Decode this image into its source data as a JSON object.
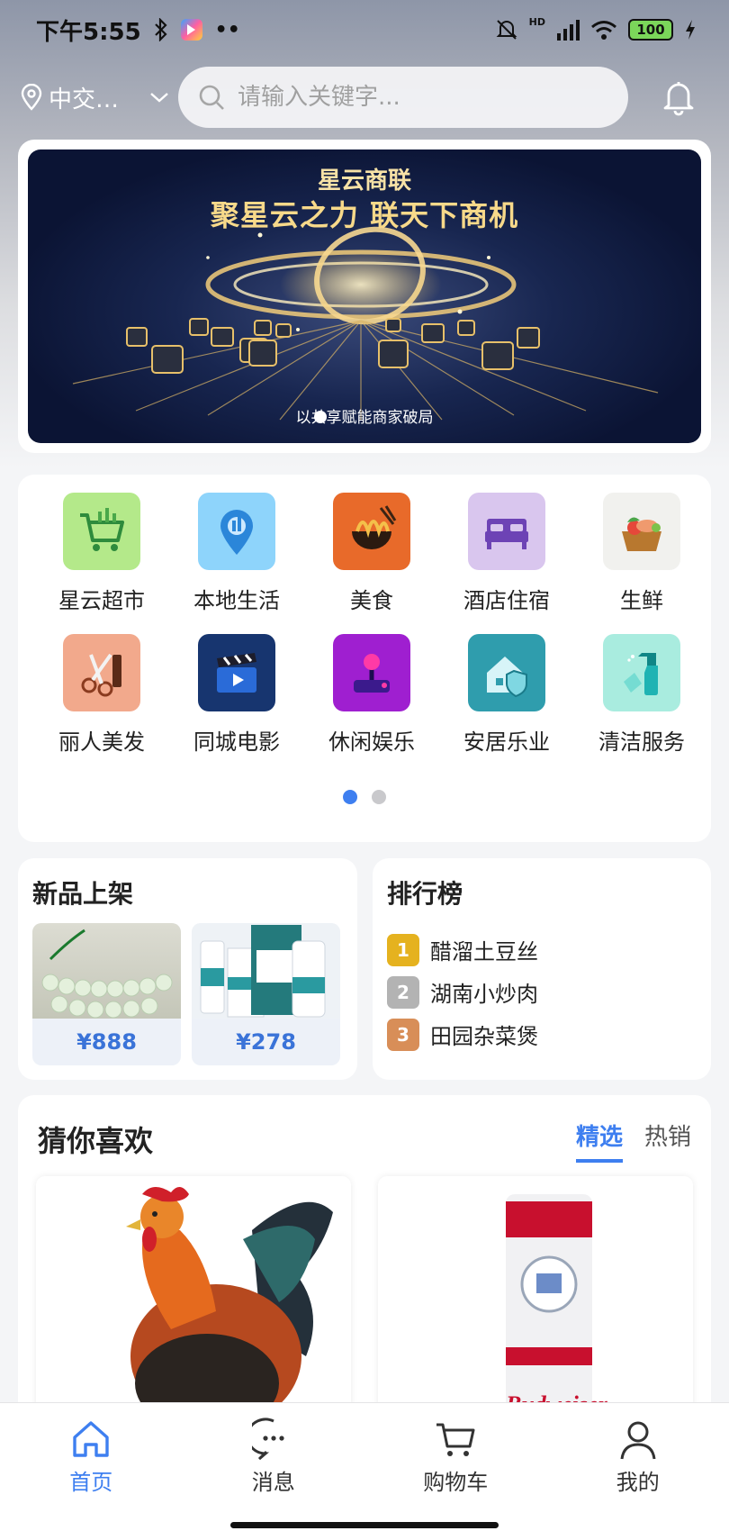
{
  "status_bar": {
    "time": "下午5:55",
    "battery": "100",
    "network": "HD"
  },
  "header": {
    "location": "中交…",
    "search_placeholder": "请输入关键字..."
  },
  "banner": {
    "title": "星云商联",
    "slogan": "聚星云之力 联天下商机",
    "subtitle": "以共享赋能商家破局"
  },
  "categories": [
    {
      "label": "星云超市",
      "icon": "cart-icon",
      "color": "#b4e98a"
    },
    {
      "label": "本地生活",
      "icon": "map-pin-icon",
      "color": "#8ed4fb"
    },
    {
      "label": "美食",
      "icon": "noodle-bowl-icon",
      "color": "#e86a2a"
    },
    {
      "label": "酒店住宿",
      "icon": "bed-icon",
      "color": "#d9c6ee"
    },
    {
      "label": "生鲜",
      "icon": "basket-icon",
      "color": "#f1f1ee"
    },
    {
      "label": "丽人美发",
      "icon": "scissors-icon",
      "color": "#f2a98c"
    },
    {
      "label": "同城电影",
      "icon": "clapperboard-icon",
      "color": "#17356f"
    },
    {
      "label": "休闲娱乐",
      "icon": "joystick-icon",
      "color": "#9f1fd0"
    },
    {
      "label": "安居乐业",
      "icon": "house-shield-icon",
      "color": "#2f9dad"
    },
    {
      "label": "清洁服务",
      "icon": "spray-bottle-icon",
      "color": "#a9ecdf"
    }
  ],
  "category_pager": {
    "pages": 2,
    "active": 1
  },
  "new_products": {
    "title": "新品上架",
    "items": [
      {
        "price": "¥888",
        "image": "jade-bracelet-image"
      },
      {
        "price": "¥278",
        "image": "disinfectant-products-image"
      }
    ]
  },
  "ranking": {
    "title": "排行榜",
    "items": [
      {
        "rank": "1",
        "name": "醋溜土豆丝",
        "color": "#e5b21f"
      },
      {
        "rank": "2",
        "name": "湖南小炒肉",
        "color": "#b3b3b3"
      },
      {
        "rank": "3",
        "name": "田园杂菜煲",
        "color": "#d88e58"
      }
    ]
  },
  "guess": {
    "title": "猜你喜欢",
    "tabs": [
      "精选",
      "热销"
    ],
    "active_tab": 0,
    "products": [
      {
        "image": "rooster-image"
      },
      {
        "image": "budweiser-can-image",
        "brand_text": "Budweiser"
      }
    ]
  },
  "tabbar": {
    "items": [
      {
        "label": "首页",
        "icon": "home-icon"
      },
      {
        "label": "消息",
        "icon": "message-icon"
      },
      {
        "label": "购物车",
        "icon": "cart-icon"
      },
      {
        "label": "我的",
        "icon": "user-icon"
      }
    ],
    "active": 0
  },
  "colors": {
    "accent": "#3e7ff0"
  }
}
